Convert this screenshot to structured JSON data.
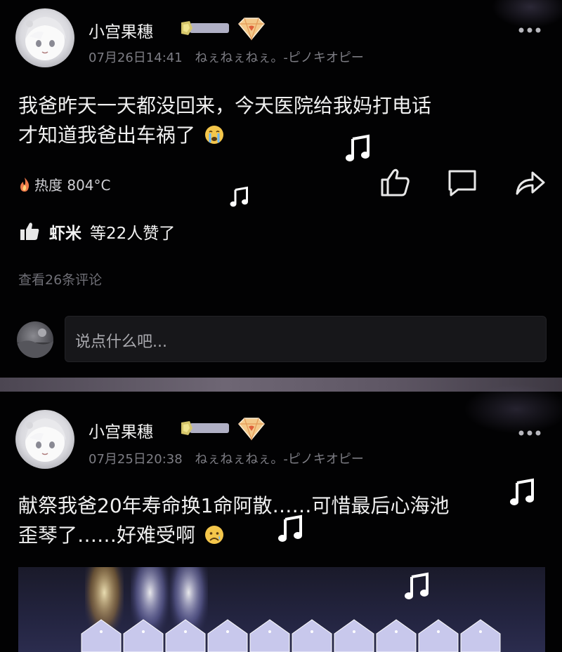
{
  "posts": [
    {
      "username": "小宫果穗",
      "timestamp": "07月26日14:41",
      "signature": "ねぇねぇねぇ。-ピノキオピー",
      "content_line1": "我爸昨天一天都没回来，今天医院给我妈打电话",
      "content_line2": "才知道我爸出车祸了",
      "content_emoji": "crying-face-icon",
      "heat_label": "热度 804°C",
      "likes_user": "虾米",
      "likes_suffix": "等22人赞了",
      "view_comments": "查看26条评论",
      "comment_placeholder": "说点什么吧..."
    },
    {
      "username": "小宫果穗",
      "timestamp": "07月25日20:38",
      "signature": "ねぇねぇねぇ。-ピノキオピー",
      "content_line1": "献祭我爸20年寿命换1命阿散……可惜最后心海池",
      "content_line2": "歪琴了……好难受啊",
      "content_emoji": "sad-face-icon"
    }
  ],
  "icons": {
    "more": "more-icon",
    "like": "thumbs-up-icon",
    "comment": "comment-icon",
    "share": "share-icon",
    "heat": "flame-icon",
    "music": "music-note-icon"
  },
  "colors": {
    "background": "#020203",
    "text": "#f0f0f0",
    "muted": "#7d7d84",
    "divider": "#6e6674",
    "badge_gold": "#d6b35a",
    "gem": "#f0b070"
  }
}
